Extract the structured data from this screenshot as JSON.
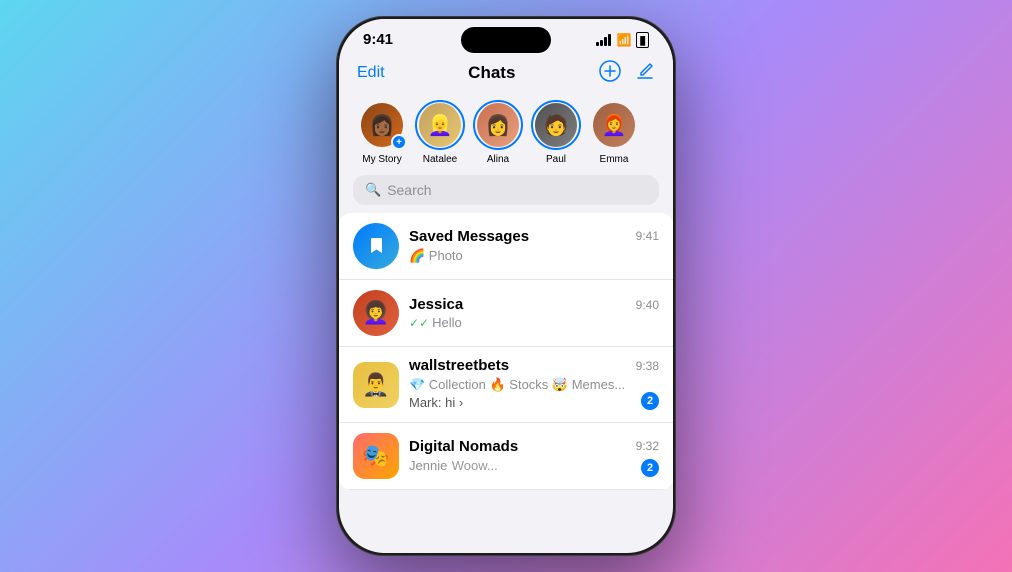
{
  "background": {
    "gradient": "linear-gradient(135deg, #5dd6f0 0%, #a78bfa 50%, #f472b6 100%)"
  },
  "statusBar": {
    "time": "9:41",
    "signalIcon": "signal-icon",
    "wifiIcon": "wifi-icon",
    "batteryIcon": "battery-icon"
  },
  "header": {
    "editLabel": "Edit",
    "title": "Chats",
    "newGroupIcon": "new-group-icon",
    "composeIcon": "compose-icon"
  },
  "stories": [
    {
      "name": "My Story",
      "avatarEmoji": "👩🏾",
      "hasRing": false,
      "hasAddBadge": true,
      "bgClass": "av-woman1"
    },
    {
      "name": "Natalee",
      "avatarEmoji": "👱‍♀️",
      "hasRing": true,
      "hasAddBadge": false,
      "bgClass": "av-natalee"
    },
    {
      "name": "Alina",
      "avatarEmoji": "👩",
      "hasRing": true,
      "hasAddBadge": false,
      "bgClass": "av-alina"
    },
    {
      "name": "Paul",
      "avatarEmoji": "🧑",
      "hasRing": true,
      "hasAddBadge": false,
      "bgClass": "av-paul"
    },
    {
      "name": "Emma",
      "avatarEmoji": "👩‍🦰",
      "hasRing": false,
      "hasAddBadge": false,
      "bgClass": "av-emma"
    }
  ],
  "search": {
    "placeholder": "Search"
  },
  "chats": [
    {
      "id": "saved",
      "name": "Saved Messages",
      "preview": "🌈 Photo",
      "time": "9:41",
      "avatarType": "saved",
      "hasBadge": false,
      "hasCheck": false,
      "hasSubpreview": ""
    },
    {
      "id": "jessica",
      "name": "Jessica",
      "preview": "Hello",
      "time": "9:40",
      "avatarEmoji": "👩‍🦱",
      "avatarBg": "av-jessica",
      "hasBadge": false,
      "hasCheck": true
    },
    {
      "id": "wallstreetbets",
      "name": "wallstreetbets",
      "preview": "💎 Collection 🔥 Stocks 🤯 Memes...",
      "subPreview": "Mark: hi ›",
      "time": "9:38",
      "avatarEmoji": "🤵‍♂️",
      "avatarBg": "av-wsb",
      "avatarSquare": true,
      "hasBadge": true,
      "badgeCount": "2",
      "hasCheck": false
    },
    {
      "id": "digital-nomads",
      "name": "Digital Nomads",
      "preview": "Jennie",
      "subPreview": "Woow...",
      "time": "9:32",
      "avatarEmoji": "🎭",
      "avatarBg": "av-digital",
      "avatarSquare": true,
      "hasBadge": true,
      "badgeCount": "2",
      "hasCheck": false
    }
  ]
}
